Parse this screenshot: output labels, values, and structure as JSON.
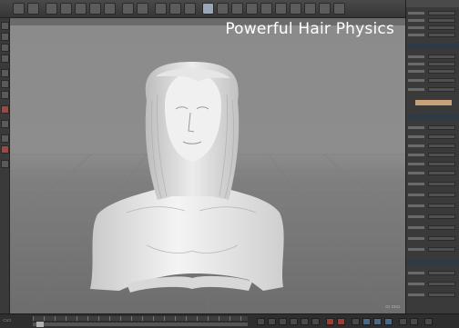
{
  "overlay": {
    "title": "Powerful Hair Physics"
  },
  "colors": {
    "viewport_bg": "#8b8b8b",
    "model": "#e8e8e8",
    "panel_bg": "#3a3a3a",
    "accent_record": "#a23b35"
  },
  "icons": {
    "top_toolbar": [
      "undo-icon",
      "redo-icon",
      "select-icon",
      "move-icon",
      "scale-icon",
      "rotate-icon",
      "render-icon",
      "cube-icon",
      "light-icon",
      "camera-icon"
    ],
    "left_toolbar": [
      "mode-icon",
      "points-icon",
      "edges-icon",
      "polygons-icon",
      "axis-icon",
      "snap-icon",
      "workplane-icon",
      "solo-icon"
    ],
    "timeline": [
      "goto-start-icon",
      "prev-frame-icon",
      "play-reverse-icon",
      "play-icon",
      "next-frame-icon",
      "goto-end-icon",
      "record-icon",
      "keyframe-icon"
    ]
  }
}
